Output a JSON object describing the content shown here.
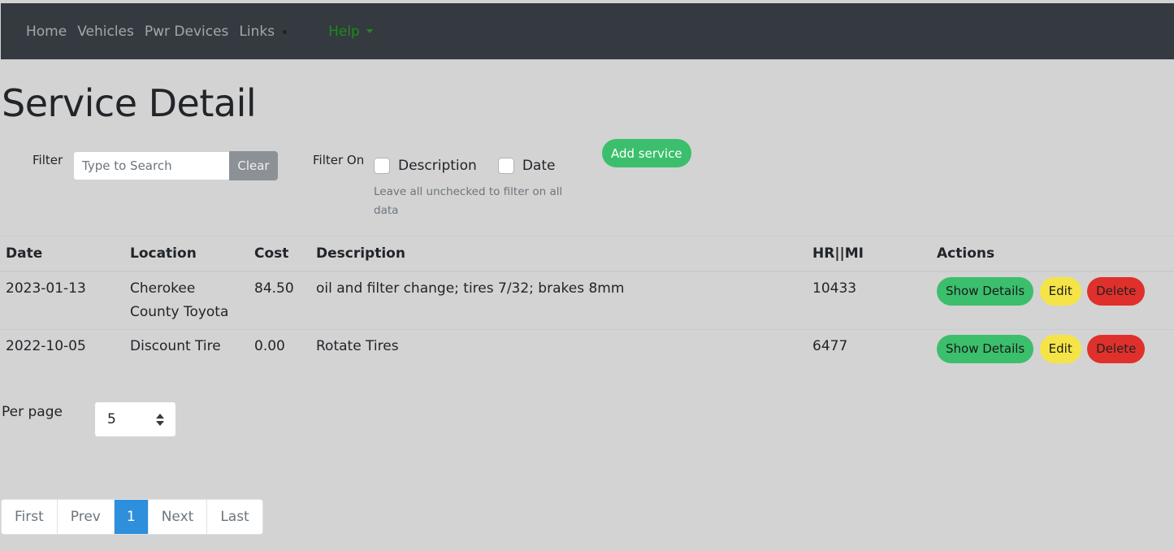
{
  "nav": {
    "items": [
      "Home",
      "Vehicles",
      "Pwr Devices",
      "Links"
    ],
    "help": "Help"
  },
  "page": {
    "title": "Service Detail"
  },
  "filter": {
    "label": "Filter",
    "placeholder": "Type to Search",
    "clear": "Clear",
    "filter_on_label": "Filter On",
    "options": [
      "Description",
      "Date"
    ],
    "help_text": "Leave all unchecked to filter on all data"
  },
  "add_button": "Add service",
  "table": {
    "headers": [
      "Date",
      "Location",
      "Cost",
      "Description",
      "HR||MI",
      "Actions"
    ],
    "rows": [
      {
        "date": "2023-01-13",
        "location": "Cherokee County Toyota",
        "cost": "84.50",
        "description": "oil and filter change; tires 7/32; brakes 8mm",
        "hrmi": "10433"
      },
      {
        "date": "2022-10-05",
        "location": "Discount Tire",
        "cost": "0.00",
        "description": "Rotate Tires",
        "hrmi": "6477"
      }
    ],
    "actions": {
      "show": "Show Details",
      "edit": "Edit",
      "delete": "Delete"
    }
  },
  "per_page": {
    "label": "Per page",
    "value": "5"
  },
  "pagination": {
    "first": "First",
    "prev": "Prev",
    "current": "1",
    "next": "Next",
    "last": "Last"
  },
  "colors": {
    "navbar": "#343a40",
    "background": "#d3d3d3",
    "success": "#3bbf6c",
    "warning": "#f5e447",
    "danger": "#e0302b",
    "primary": "#2e8fdc"
  }
}
